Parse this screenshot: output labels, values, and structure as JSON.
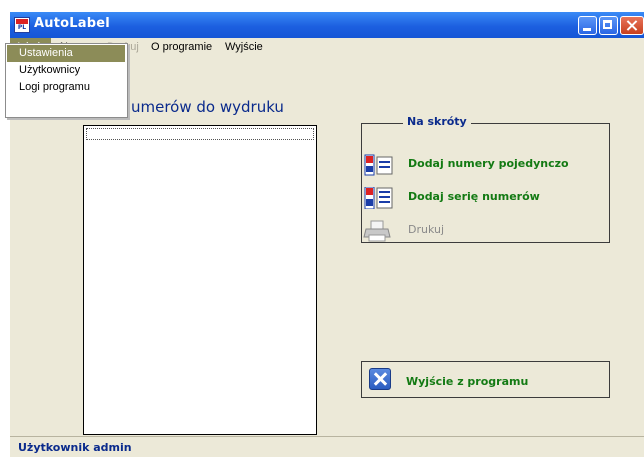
{
  "window": {
    "title": "AutoLabel"
  },
  "menubar": {
    "items": [
      {
        "label": "Admin",
        "state": "open"
      },
      {
        "label": "Numery",
        "state": "normal"
      },
      {
        "label": "Drukuj",
        "state": "disabled"
      },
      {
        "label": "O programie",
        "state": "normal"
      },
      {
        "label": "Wyjście",
        "state": "normal"
      }
    ]
  },
  "admin_menu": {
    "items": [
      {
        "label": "Ustawienia",
        "highlighted": true
      },
      {
        "label": "Użytkownicy",
        "highlighted": false
      },
      {
        "label": "Logi programu",
        "highlighted": false
      }
    ]
  },
  "main": {
    "heading": "umerów do wydruku"
  },
  "shortcuts": {
    "legend": "Na skróty",
    "items": [
      {
        "label": "Dodaj numery pojedynczo",
        "icon": "single-numbers-icon",
        "enabled": true
      },
      {
        "label": "Dodaj serię numerów",
        "icon": "number-series-icon",
        "enabled": true
      },
      {
        "label": "Drukuj",
        "icon": "printer-icon",
        "enabled": false
      }
    ]
  },
  "exit": {
    "label": "Wyjście z programu",
    "icon": "close-x-icon"
  },
  "status": {
    "text": "Użytkownik admin"
  },
  "colors": {
    "titlebar": "#1c5fe0",
    "window_bg": "#ece9d8",
    "menu_highlight": "#8c8c58",
    "heading_text": "#0a2a8c",
    "shortcut_text": "#137a13",
    "disabled_text": "#8a8a8a"
  }
}
